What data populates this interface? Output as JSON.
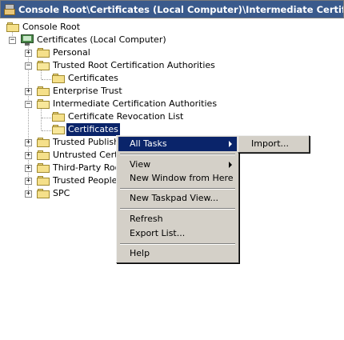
{
  "window": {
    "title": "Console Root\\Certificates (Local Computer)\\Intermediate Certification Au"
  },
  "tree": {
    "root": "Console Root",
    "certificates_store": "Certificates (Local Computer)",
    "personal": "Personal",
    "trusted_root": "Trusted Root Certification Authorities",
    "trusted_root_certificates": "Certificates",
    "enterprise_trust": "Enterprise Trust",
    "intermediate": "Intermediate Certification Authorities",
    "crl": "Certificate Revocation List",
    "intermediate_certificates": "Certificates",
    "trusted_publishers": "Trusted Publishe",
    "untrusted_certificates": "Untrusted Certif",
    "third_party_root": "Third-Party Rool",
    "trusted_people": "Trusted People",
    "spc": "SPC"
  },
  "context_menu": {
    "all_tasks": "All Tasks",
    "view": "View",
    "new_window": "New Window from Here",
    "new_taskpad": "New Taskpad View...",
    "refresh": "Refresh",
    "export_list": "Export List...",
    "help": "Help"
  },
  "submenu": {
    "import": "Import..."
  },
  "colors": {
    "selection": "#0a246a",
    "menu_bg": "#d4d0c8",
    "titlebar": "#3a5a8c"
  }
}
